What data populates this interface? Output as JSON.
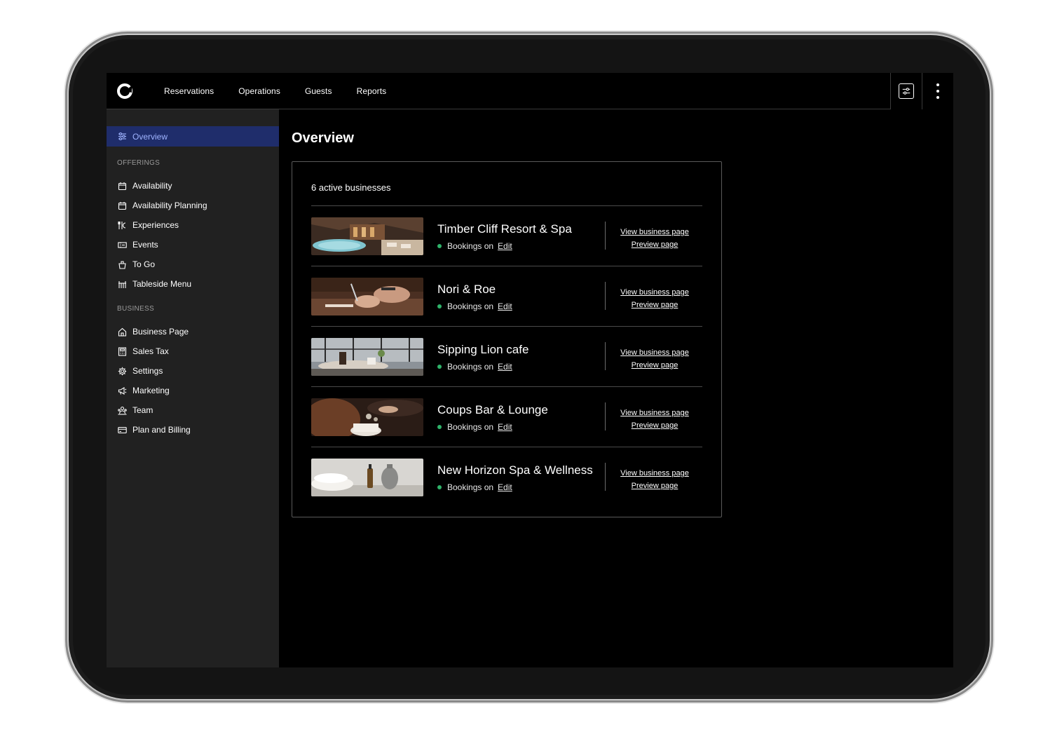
{
  "topbar": {
    "nav": [
      "Reservations",
      "Operations",
      "Guests",
      "Reports"
    ]
  },
  "sidebar": {
    "active": {
      "label": "Overview",
      "icon": "sliders-icon"
    },
    "sections": [
      {
        "title": "OFFERINGS",
        "items": [
          {
            "label": "Availability",
            "icon": "calendar-icon"
          },
          {
            "label": "Availability Planning",
            "icon": "calendar-icon"
          },
          {
            "label": "Experiences",
            "icon": "dining-icon"
          },
          {
            "label": "Events",
            "icon": "ticket-icon"
          },
          {
            "label": "To Go",
            "icon": "takeout-bag-icon"
          },
          {
            "label": "Tableside Menu",
            "icon": "table-icon"
          }
        ]
      },
      {
        "title": "BUSINESS",
        "items": [
          {
            "label": "Business Page",
            "icon": "home-icon"
          },
          {
            "label": "Sales Tax",
            "icon": "calculator-icon"
          },
          {
            "label": "Settings",
            "icon": "gear-icon"
          },
          {
            "label": "Marketing",
            "icon": "megaphone-icon"
          },
          {
            "label": "Team",
            "icon": "team-icon"
          },
          {
            "label": "Plan and Billing",
            "icon": "credit-card-icon"
          }
        ]
      }
    ]
  },
  "main": {
    "title": "Overview",
    "card_header": "6 active businesses",
    "businesses": [
      {
        "name": "Timber Cliff Resort & Spa",
        "status": "Bookings on",
        "edit": "Edit",
        "view": "View business page",
        "preview": "Preview page",
        "thumb": "resort-pool-photo"
      },
      {
        "name": "Nori & Roe",
        "status": "Bookings on",
        "edit": "Edit",
        "view": "View business page",
        "preview": "Preview page",
        "thumb": "sushi-chef-photo"
      },
      {
        "name": "Sipping Lion cafe",
        "status": "Bookings on",
        "edit": "Edit",
        "view": "View business page",
        "preview": "Preview page",
        "thumb": "cafe-table-photo"
      },
      {
        "name": "Coups Bar & Lounge",
        "status": "Bookings on",
        "edit": "Edit",
        "view": "View business page",
        "preview": "Preview page",
        "thumb": "cocktail-photo"
      },
      {
        "name": "New Horizon Spa & Wellness",
        "status": "Bookings on",
        "edit": "Edit",
        "view": "View business page",
        "preview": "Preview page",
        "thumb": "spa-towels-photo"
      }
    ]
  },
  "colors": {
    "active_bg": "#1f2d6b",
    "active_text": "#9fb4ff",
    "status_green": "#2fb36a",
    "sidebar_bg": "#212121"
  }
}
